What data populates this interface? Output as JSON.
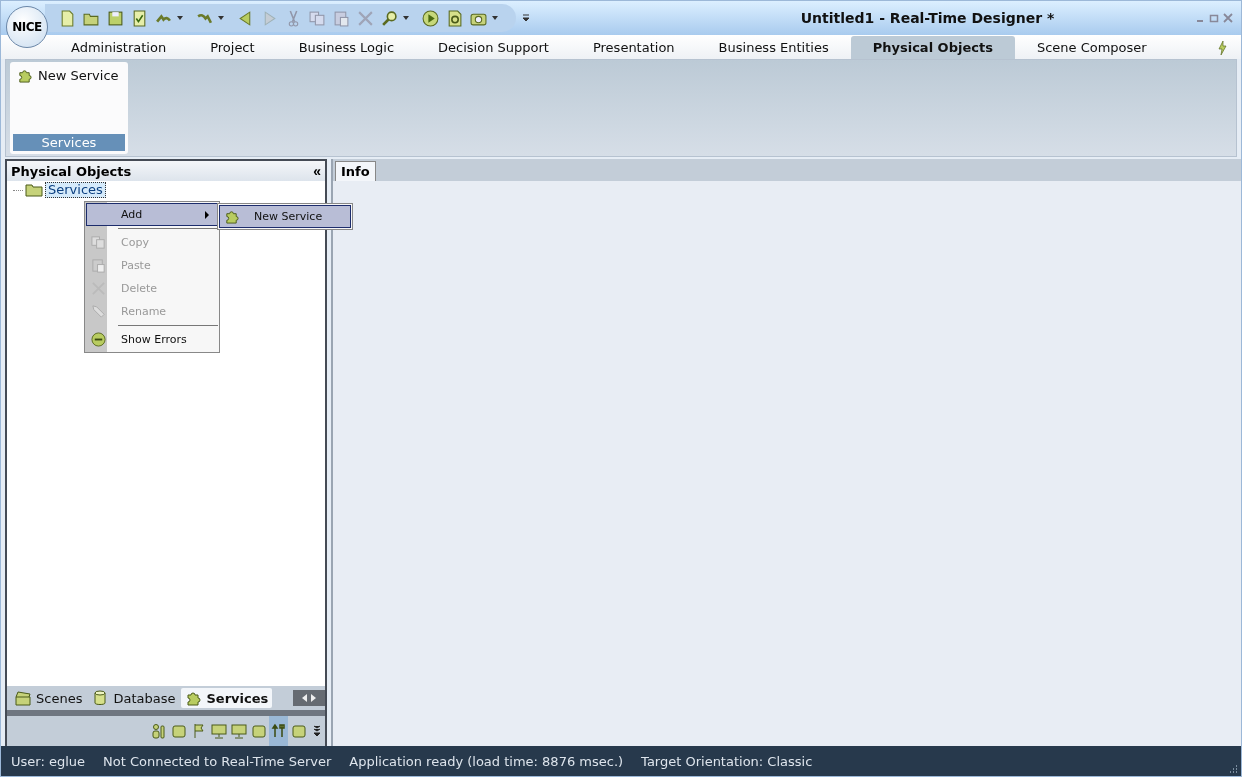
{
  "window": {
    "logo": "NICE",
    "title": "Untitled1 - Real-Time Designer *"
  },
  "ribbon_tabs": [
    {
      "label": "Administration",
      "selected": false
    },
    {
      "label": "Project",
      "selected": false
    },
    {
      "label": "Business Logic",
      "selected": false
    },
    {
      "label": "Decision Support",
      "selected": false
    },
    {
      "label": "Presentation",
      "selected": false
    },
    {
      "label": "Business Entities",
      "selected": false
    },
    {
      "label": "Physical Objects",
      "selected": true
    },
    {
      "label": "Scene Composer",
      "selected": false
    }
  ],
  "ribbon_group": {
    "button": "New Service",
    "label": "Services"
  },
  "left_panel": {
    "title": "Physical Objects",
    "collapse": "«",
    "tree": [
      {
        "label": "Services",
        "selected": true
      }
    ],
    "bottom_tabs": [
      {
        "label": "Scenes",
        "selected": false
      },
      {
        "label": "Database",
        "selected": false
      },
      {
        "label": "Services",
        "selected": true
      }
    ]
  },
  "context_menu": [
    {
      "kind": "submenu",
      "label": "Add",
      "disabled": false,
      "selected": true
    },
    {
      "kind": "separator"
    },
    {
      "kind": "item",
      "label": "Copy",
      "disabled": true,
      "selected": false
    },
    {
      "kind": "item",
      "label": "Paste",
      "disabled": true,
      "selected": false
    },
    {
      "kind": "item",
      "label": "Delete",
      "disabled": true,
      "selected": false
    },
    {
      "kind": "item",
      "label": "Rename",
      "disabled": true,
      "selected": false
    },
    {
      "kind": "separator"
    },
    {
      "kind": "item",
      "label": "Show Errors",
      "disabled": false,
      "selected": false
    }
  ],
  "submenu": [
    {
      "label": "New Service",
      "selected": true
    }
  ],
  "right_panel": {
    "tabs": [
      {
        "label": "Info",
        "selected": true
      }
    ]
  },
  "status_bar": [
    "User: eglue",
    "Not Connected to Real-Time Server",
    "Application ready (load time: 8876 msec.)",
    "Target Orientation: Classic"
  ]
}
